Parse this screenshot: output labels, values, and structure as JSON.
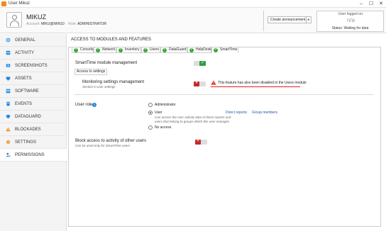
{
  "window": {
    "title": "User Mikuz"
  },
  "user": {
    "name": "MIKUZ",
    "account_label": "Account:",
    "account": "MIKU@WIN10",
    "role_label": "Role:",
    "role": "ADMINISTRATOR"
  },
  "header": {
    "announcement_button": "Create announcement...",
    "logged_on_label": "User logged on:",
    "logged_on_value": "n/a",
    "status": "Status: Waiting for data"
  },
  "sidebar": {
    "items": [
      {
        "label": "GENERAL",
        "icon": "settings-icon",
        "color": "#1e88e5"
      },
      {
        "label": "ACTIVITY",
        "icon": "activity-icon",
        "color": "#1e88e5"
      },
      {
        "label": "SCREENSHOTS",
        "icon": "screenshot-icon",
        "color": "#1e88e5"
      },
      {
        "label": "ASSETS",
        "icon": "assets-icon",
        "color": "#1e88e5"
      },
      {
        "label": "SOFTWARE",
        "icon": "software-icon",
        "color": "#1e88e5"
      },
      {
        "label": "EVENTS",
        "icon": "events-icon",
        "color": "#1e88e5"
      },
      {
        "label": "DATAGUARD",
        "icon": "dataguard-icon",
        "color": "#1e88e5"
      },
      {
        "label": "BLOCKADES",
        "icon": "warning-icon",
        "color": "#f08a1c"
      },
      {
        "label": "SETTINGS",
        "icon": "gear-icon",
        "color": "#f08a1c"
      },
      {
        "label": "PERMISSIONS",
        "icon": "permissions-icon",
        "color": "#1e88e5",
        "active": true
      }
    ]
  },
  "content": {
    "title": "ACCESS TO MODULES AND FEATURES",
    "tabs": [
      {
        "label": "Console"
      },
      {
        "label": "Network"
      },
      {
        "label": "Inventory"
      },
      {
        "label": "Users"
      },
      {
        "label": "DataGuard"
      },
      {
        "label": "HelpDesk"
      },
      {
        "label": "SmartTime",
        "active": true
      }
    ],
    "module_management": "SmartTime module management",
    "access_to_settings": "Access to settings",
    "monitoring": {
      "title": "Monitoring settings management",
      "subtitle": "Section in user settings",
      "warning": "This feature has also been disabled in the Users module"
    },
    "user_role": {
      "label": "User role",
      "options": [
        {
          "label": "Administrator",
          "selected": false
        },
        {
          "label": "User",
          "selected": true,
          "desc_1": "Can access the user activity data of direct reports and",
          "desc_2": "users that belong to groups which this user manages"
        },
        {
          "label": "No access",
          "selected": false
        }
      ],
      "direct_reports": "Direct reports",
      "group_members": "Group members"
    },
    "block_access": {
      "title": "Block access to activity of other users",
      "subtitle": "Can be used only for SmartTime users"
    }
  }
}
